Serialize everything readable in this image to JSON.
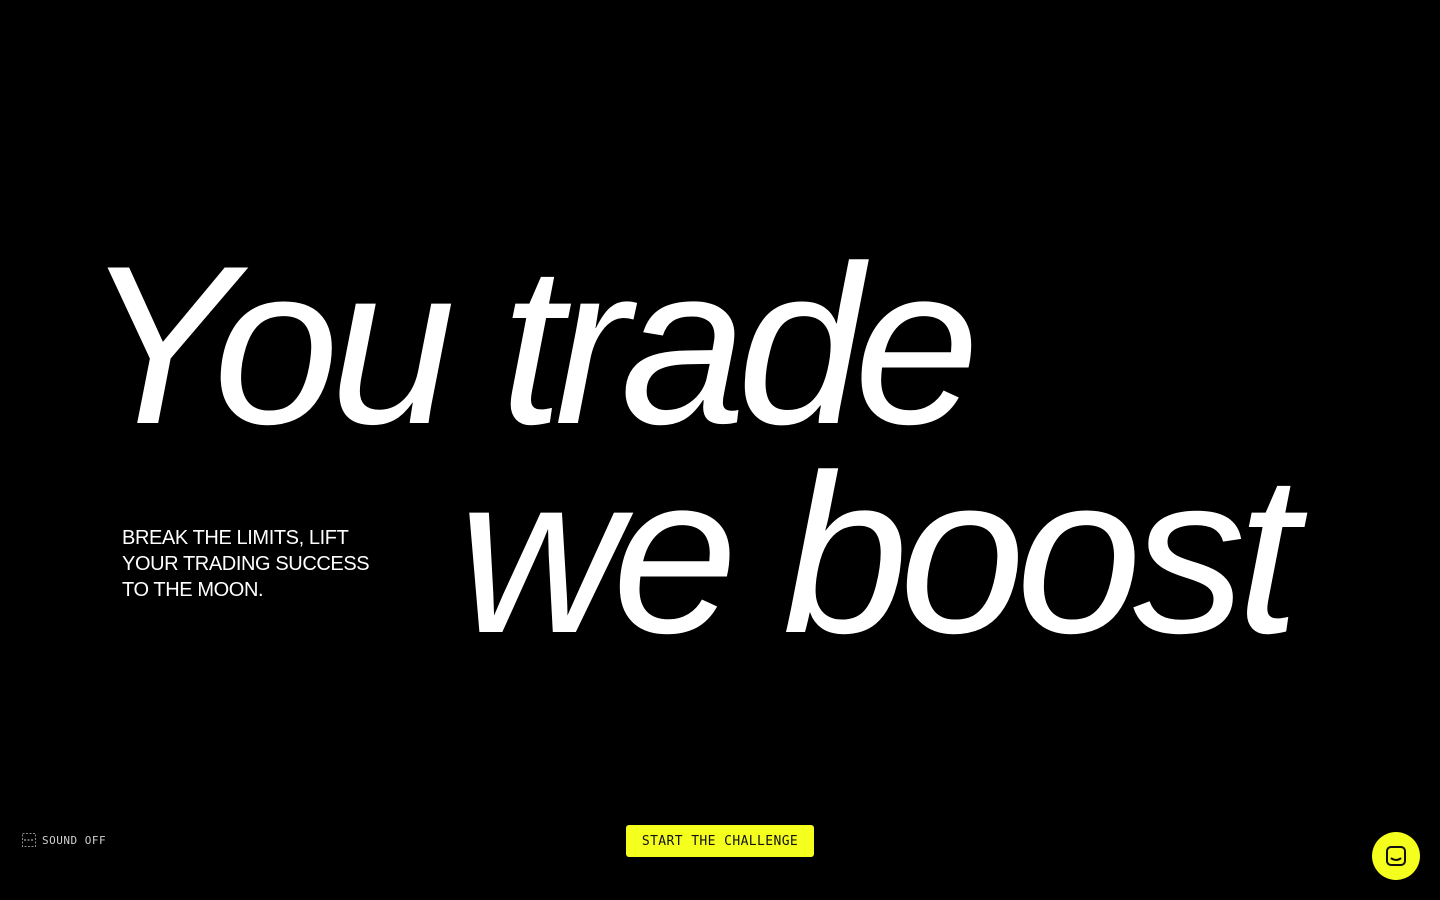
{
  "hero": {
    "headline_line1": "You trade",
    "headline_line2": "we boost",
    "tagline_lines": [
      "BREAK THE LIMITS, LIFT",
      "YOUR TRADING SUCCESS",
      "TO THE MOON."
    ]
  },
  "controls": {
    "sound_label": "SOUND OFF",
    "sound_icon": "sound-off-icon",
    "cta_label": "START THE CHALLENGE",
    "chat_icon": "chat-icon"
  },
  "colors": {
    "background": "#000000",
    "text": "#ffffff",
    "accent": "#f5ff1e"
  }
}
